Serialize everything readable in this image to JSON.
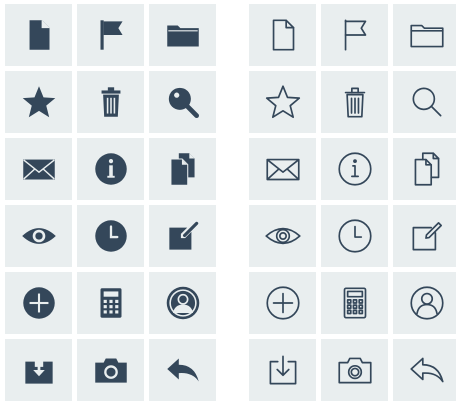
{
  "page": {
    "background": "#ffffff",
    "tile_color": "#e9eeef",
    "icon_color": "#34475a"
  },
  "icon_sets": [
    {
      "style": "solid",
      "icons": [
        "document-icon",
        "flag-icon",
        "folder-icon",
        "star-icon",
        "trash-icon",
        "search-icon",
        "mail-icon",
        "info-icon",
        "copy-documents-icon",
        "eye-icon",
        "clock-icon",
        "edit-icon",
        "plus-circle-icon",
        "calculator-icon",
        "user-icon",
        "download-icon",
        "camera-icon",
        "reply-icon"
      ]
    },
    {
      "style": "outline",
      "icons": [
        "document-icon",
        "flag-icon",
        "folder-icon",
        "star-icon",
        "trash-icon",
        "search-icon",
        "mail-icon",
        "info-icon",
        "copy-documents-icon",
        "eye-icon",
        "clock-icon",
        "edit-icon",
        "plus-circle-icon",
        "calculator-icon",
        "user-icon",
        "download-icon",
        "camera-icon",
        "reply-icon"
      ]
    }
  ]
}
